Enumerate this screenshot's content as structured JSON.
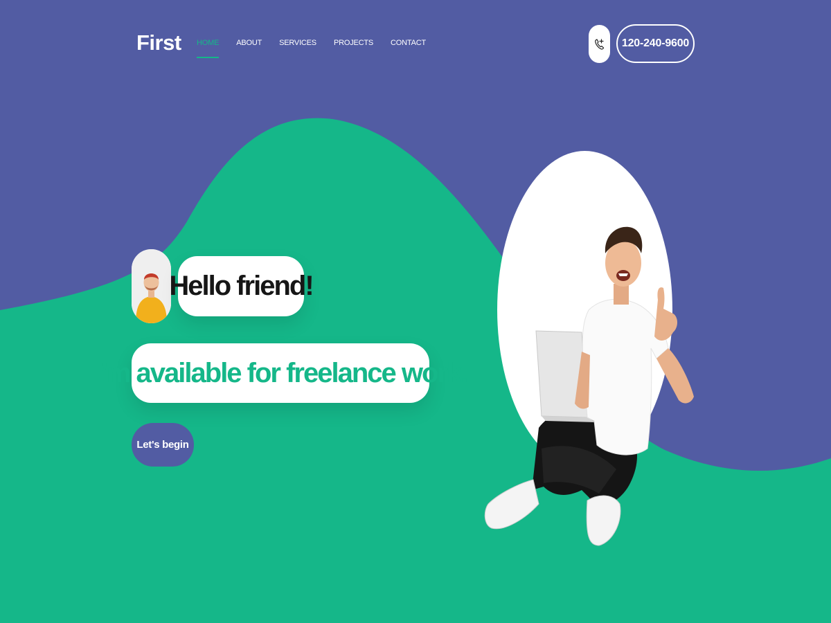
{
  "brand": "First",
  "nav": {
    "items": [
      {
        "label": "HOME",
        "active": true
      },
      {
        "label": "ABOUT",
        "active": false
      },
      {
        "label": "SERVICES",
        "active": false
      },
      {
        "label": "PROJECTS",
        "active": false
      },
      {
        "label": "CONTACT",
        "active": false
      }
    ]
  },
  "header": {
    "call_icon": "phone-call-icon",
    "phone": "120-240-9600"
  },
  "hero": {
    "greeting": "Hello friend!",
    "tagline": "I’m available for freelance work.",
    "cta_label": "Let's begin"
  },
  "colors": {
    "purple": "#525ca3",
    "green": "#15b789",
    "white": "#ffffff",
    "dark_text": "#161616"
  }
}
